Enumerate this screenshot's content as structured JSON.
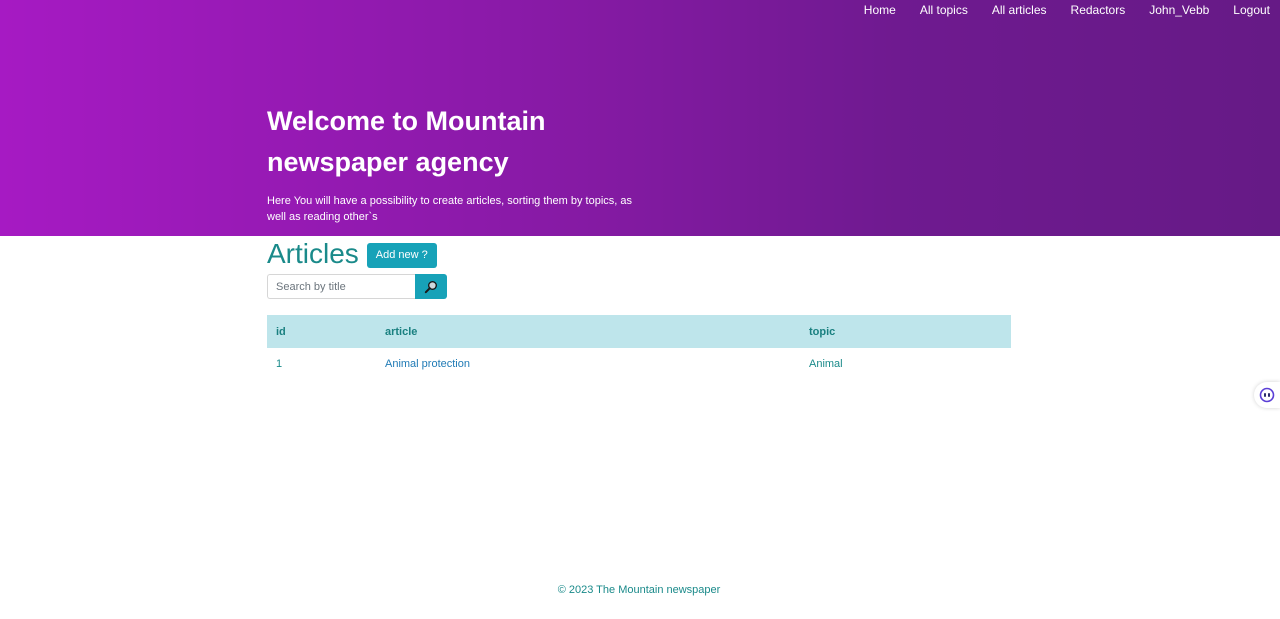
{
  "nav": {
    "items": [
      {
        "label": "Home"
      },
      {
        "label": "All topics"
      },
      {
        "label": "All articles"
      },
      {
        "label": "Redactors"
      },
      {
        "label": "John_Vebb"
      },
      {
        "label": "Logout"
      }
    ]
  },
  "hero": {
    "title": "Welcome to Mountain newspaper agency",
    "text": "Here You will have a possibility to create articles, sorting them by topics, as well as reading other`s",
    "gradient_start": "#a61ac3",
    "gradient_end": "#661a86"
  },
  "articles": {
    "title": "Articles",
    "add_button": "Add new ?",
    "search_placeholder": "Search by title",
    "search_icon": "magnifier-icon",
    "table": {
      "headers": [
        "id",
        "article",
        "topic"
      ],
      "rows": [
        {
          "id": "1",
          "article": "Animal protection",
          "topic": "Animal"
        }
      ]
    }
  },
  "footer": {
    "text": "© 2023 The Mountain newspaper"
  },
  "colors": {
    "accent": "#17a2b8",
    "teal_text": "#1a8a8a",
    "table_header_bg": "#bee5eb"
  }
}
